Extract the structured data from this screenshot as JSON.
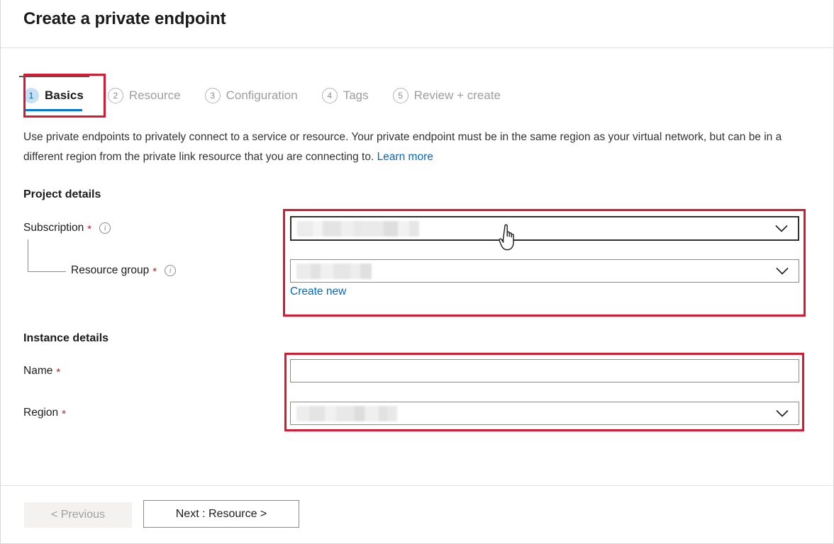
{
  "header": {
    "title": "Create a private endpoint"
  },
  "tabs": [
    {
      "number": "1",
      "label": "Basics",
      "state": "active"
    },
    {
      "number": "2",
      "label": "Resource",
      "state": "inactive"
    },
    {
      "number": "3",
      "label": "Configuration",
      "state": "inactive"
    },
    {
      "number": "4",
      "label": "Tags",
      "state": "inactive"
    },
    {
      "number": "5",
      "label": "Review + create",
      "state": "inactive"
    }
  ],
  "description": {
    "text": "Use private endpoints to privately connect to a service or resource. Your private endpoint must be in the same region as your virtual network, but can be in a different region from the private link resource that you are connecting to.",
    "link_label": "Learn more"
  },
  "project_details": {
    "heading": "Project details",
    "subscription": {
      "label": "Subscription",
      "required_marker": "*",
      "info_icon": "info-circle-icon",
      "value": "",
      "value_redacted": true,
      "chevron_icon": "chevron-down-icon"
    },
    "resource_group": {
      "label": "Resource group",
      "required_marker": "*",
      "info_icon": "info-circle-icon",
      "value": "",
      "value_redacted": true,
      "chevron_icon": "chevron-down-icon",
      "create_new_label": "Create new"
    }
  },
  "instance_details": {
    "heading": "Instance details",
    "name": {
      "label": "Name",
      "required_marker": "*",
      "value": "",
      "placeholder": ""
    },
    "region": {
      "label": "Region",
      "required_marker": "*",
      "value": "",
      "value_redacted": true,
      "chevron_icon": "chevron-down-icon"
    }
  },
  "footer": {
    "previous_label": "< Previous",
    "next_label": "Next : Resource >"
  },
  "annotations": {
    "highlight_color": "#d71931",
    "accent_color": "#0078d4",
    "link_color": "#0066cc",
    "required_color": "#a4262c",
    "boxes": [
      {
        "name": "project-details-fields-highlight"
      },
      {
        "name": "instance-details-fields-highlight"
      },
      {
        "name": "basics-tab-highlight"
      },
      {
        "name": "next-button-highlight"
      }
    ],
    "cursor": {
      "icon": "pointing-hand-cursor"
    }
  }
}
